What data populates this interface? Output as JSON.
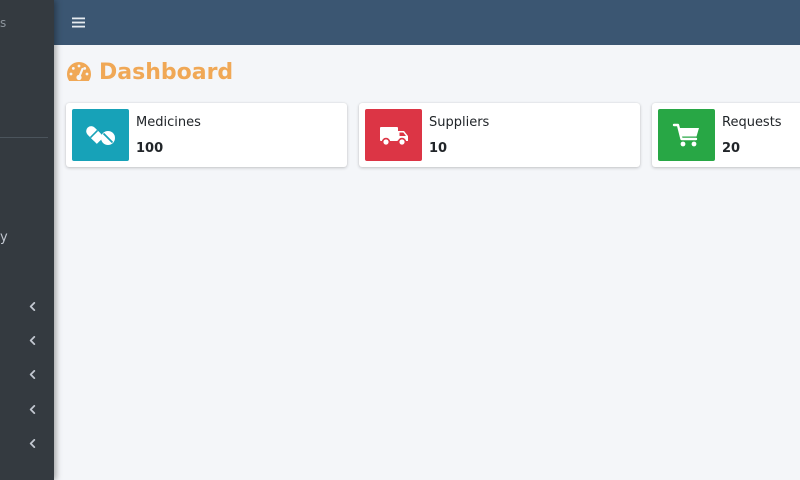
{
  "sidebar": {
    "brand_fragment": "s",
    "nav_fragment": "y",
    "chevron_count": 5
  },
  "header": {
    "menu_icon": "hamburger-icon"
  },
  "page": {
    "title": "Dashboard",
    "title_icon": "tachometer-icon",
    "title_color": "#f0a856"
  },
  "cards": [
    {
      "label": "Medicines",
      "value": "100",
      "icon": "pills-icon",
      "color": "#17a2b8"
    },
    {
      "label": "Suppliers",
      "value": "10",
      "icon": "truck-icon",
      "color": "#dc3545"
    },
    {
      "label": "Requests",
      "value": "20",
      "icon": "cart-icon",
      "color": "#28a745"
    }
  ]
}
